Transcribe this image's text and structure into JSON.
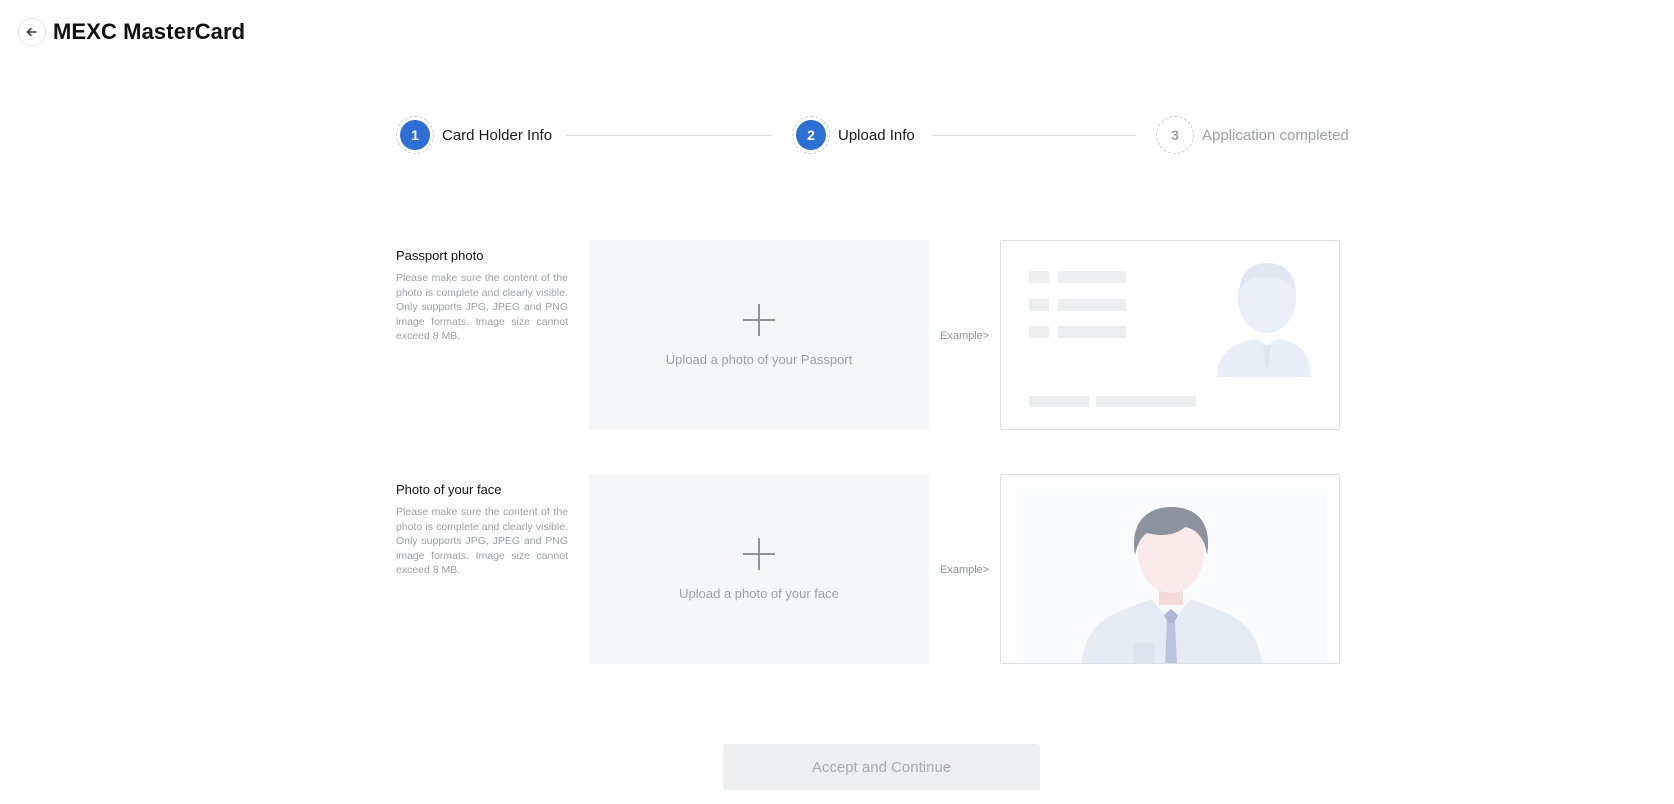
{
  "header": {
    "title": "MEXC MasterCard",
    "back_icon": "arrow-left-icon"
  },
  "steps": [
    {
      "number": "1",
      "label": "Card Holder Info",
      "state": "active"
    },
    {
      "number": "2",
      "label": "Upload Info",
      "state": "active"
    },
    {
      "number": "3",
      "label": "Application completed",
      "state": "pending"
    }
  ],
  "passport": {
    "title": "Passport photo",
    "description": "Please make sure the content of the photo is complete and clearly visible. Only supports JPG, JPEG and PNG image formats. Image size cannot exceed 8 MB.",
    "upload_text": "Upload a photo of your Passport",
    "example_label": "Example>",
    "upload_icon": "plus-icon"
  },
  "face": {
    "title": "Photo of your face",
    "description": "Please make sure the content of the photo is complete and clearly visible. Only supports JPG, JPEG and PNG image formats. Image size cannot exceed 8 MB.",
    "upload_text": "Upload a photo of your face",
    "example_label": "Example>",
    "upload_icon": "plus-icon"
  },
  "footer": {
    "continue_label": "Accept and Continue",
    "disabled": true
  },
  "colors": {
    "accent": "#2e6fd6",
    "muted_text": "#9aa0a8",
    "upload_bg": "#f5f6f8",
    "disabled_btn_bg": "#edeef0"
  }
}
